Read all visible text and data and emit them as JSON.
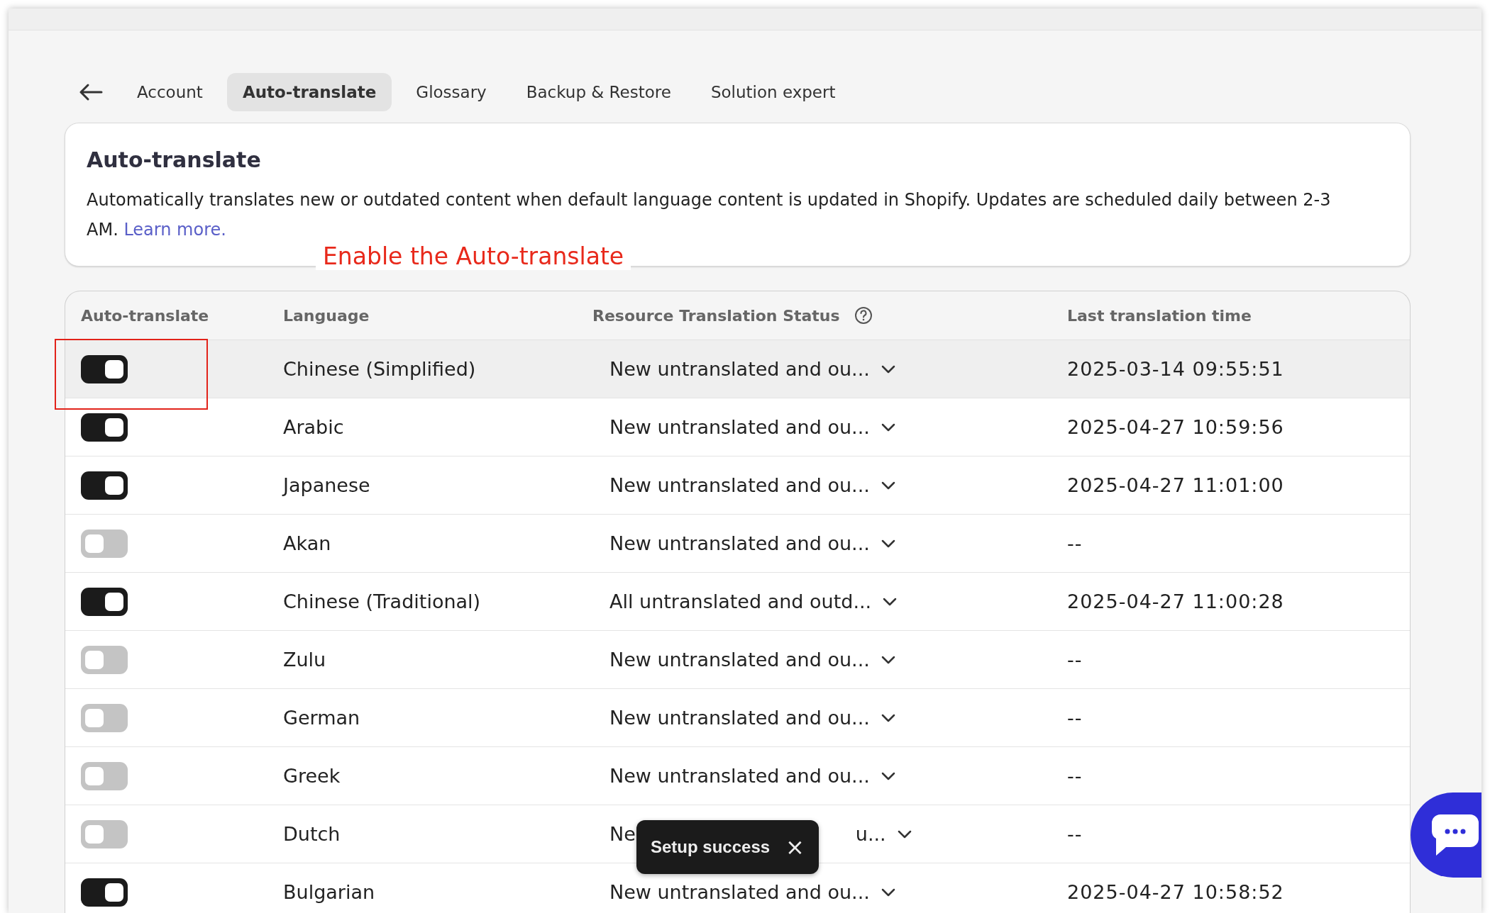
{
  "tabs": [
    {
      "label": "Account",
      "selected": false
    },
    {
      "label": "Auto-translate",
      "selected": true
    },
    {
      "label": "Glossary",
      "selected": false
    },
    {
      "label": "Backup & Restore",
      "selected": false
    },
    {
      "label": "Solution expert",
      "selected": false
    }
  ],
  "info_card": {
    "title": "Auto-translate",
    "description": "Automatically translates new or outdated content when default language content is updated in Shopify. Updates are scheduled daily between 2-3 AM.",
    "link": "Learn more."
  },
  "annotation": {
    "text": "Enable the Auto-translate"
  },
  "table": {
    "columns": [
      "Auto-translate",
      "Language",
      "Resource Translation Status",
      "Last translation time"
    ],
    "rows": [
      {
        "on": true,
        "language": "Chinese (Simplified)",
        "status": "New untranslated and ou...",
        "time": "2025-03-14 09:55:51",
        "highlighted": true
      },
      {
        "on": true,
        "language": "Arabic",
        "status": "New untranslated and ou...",
        "time": "2025-04-27 10:59:56",
        "highlighted": false
      },
      {
        "on": true,
        "language": "Japanese",
        "status": "New untranslated and ou...",
        "time": "2025-04-27 11:01:00",
        "highlighted": false
      },
      {
        "on": false,
        "language": "Akan",
        "status": "New untranslated and ou...",
        "time": "--",
        "highlighted": false
      },
      {
        "on": true,
        "language": "Chinese (Traditional)",
        "status": "All untranslated and outd...",
        "time": "2025-04-27 11:00:28",
        "highlighted": false
      },
      {
        "on": false,
        "language": "Zulu",
        "status": "New untranslated and ou...",
        "time": "--",
        "highlighted": false
      },
      {
        "on": false,
        "language": "German",
        "status": "New untranslated and ou...",
        "time": "--",
        "highlighted": false
      },
      {
        "on": false,
        "language": "Greek",
        "status": "New untranslated and ou...",
        "time": "--",
        "highlighted": false
      },
      {
        "on": false,
        "language": "Dutch",
        "status": "Ne",
        "status_end": "u...",
        "time": "--",
        "highlighted": false
      },
      {
        "on": true,
        "language": "Bulgarian",
        "status": "New untranslated and ou...",
        "time": "2025-04-27 10:58:52",
        "highlighted": false
      }
    ]
  },
  "toast": {
    "message": "Setup success",
    "close": "×"
  }
}
